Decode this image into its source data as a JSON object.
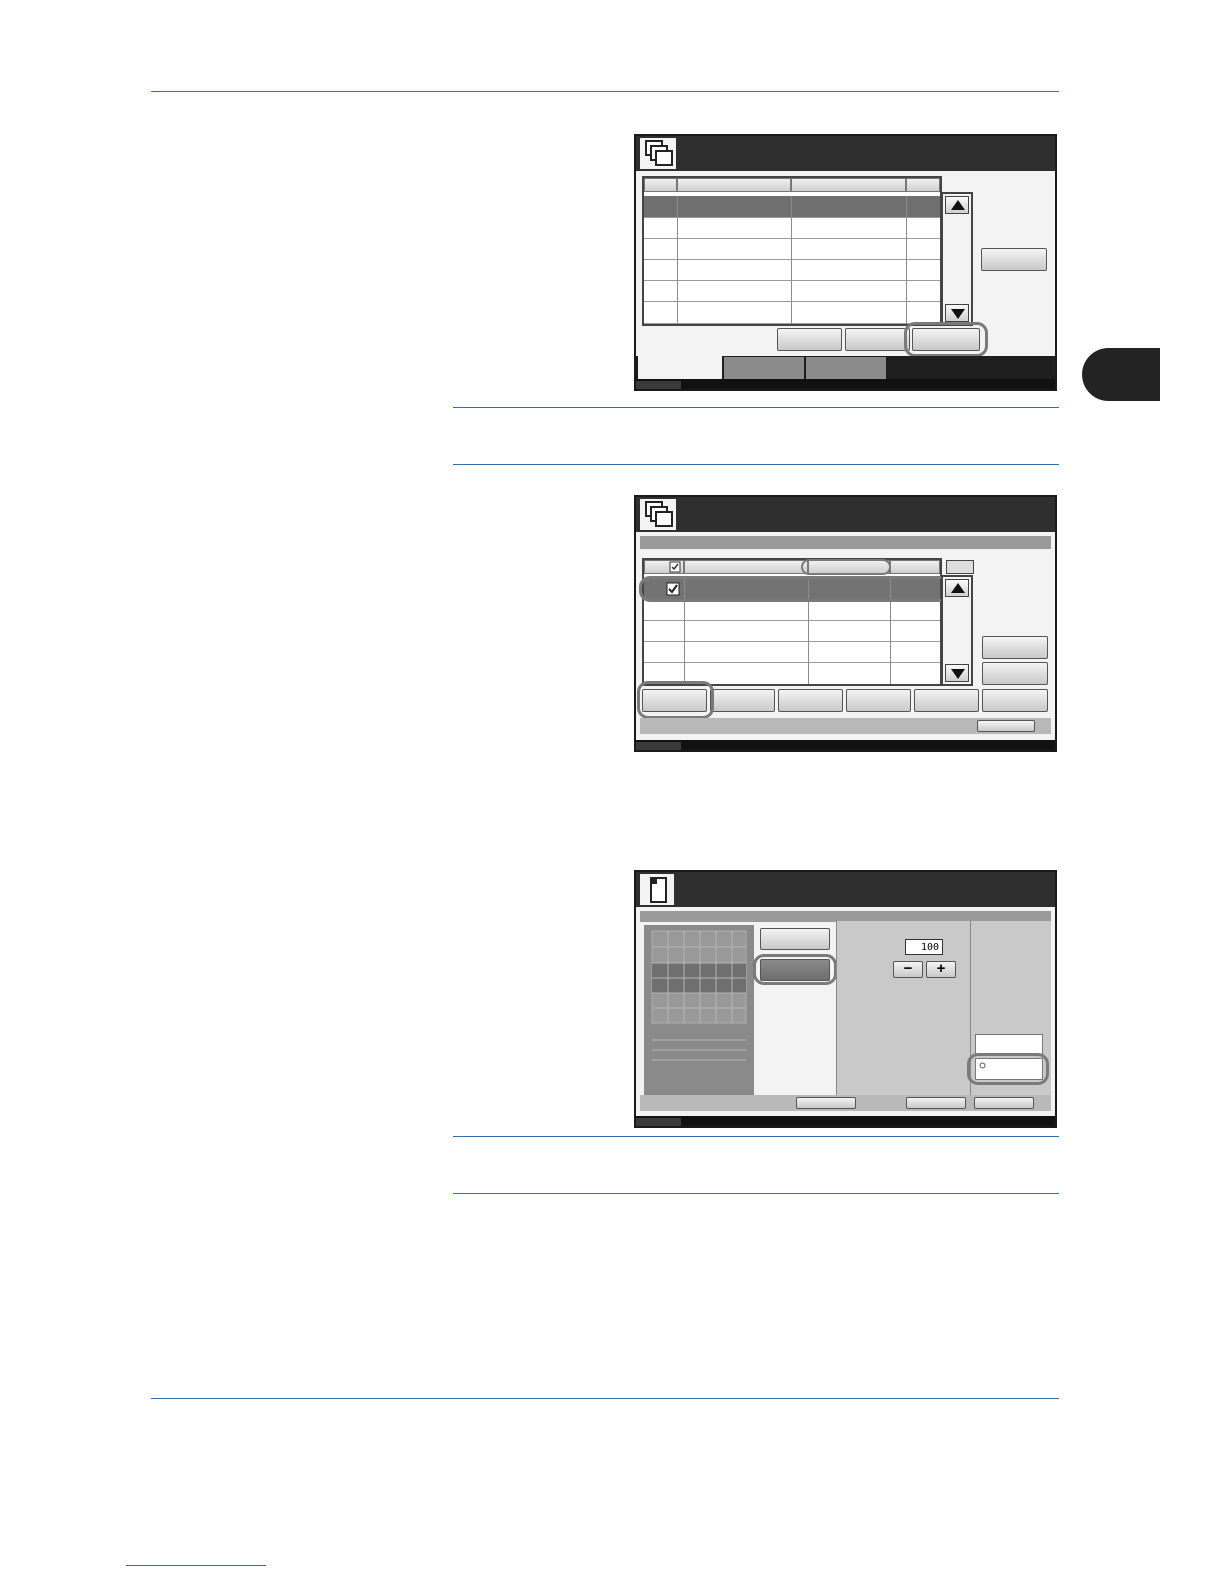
{
  "page": {
    "accent_color": "#2f6fae",
    "screen_dark_color": "#2f2f2f"
  },
  "screen3": {
    "zoom_value": "100",
    "minus_label": "−",
    "plus_label": "+"
  }
}
